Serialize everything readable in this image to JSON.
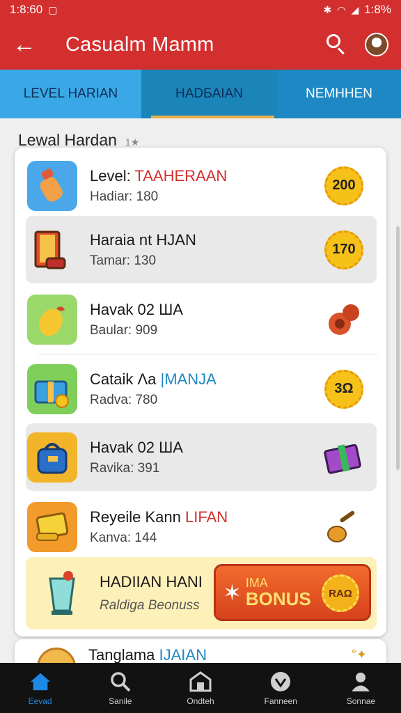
{
  "status_bar": {
    "time": "1:8:60",
    "battery": "1:8%"
  },
  "app_bar": {
    "title": "Casualm Mamm"
  },
  "tabs": [
    {
      "label": "LEVEL HARIAN"
    },
    {
      "label": "HADƂAIAN"
    },
    {
      "label": "NEMHHEN"
    }
  ],
  "section": {
    "title": "Lewal Hardan",
    "hint": "1★"
  },
  "rows": [
    {
      "name": "Level: ",
      "name_accent": "TAAHERAAN",
      "sub": "Hadiar: 180",
      "reward": "200",
      "accent": "#d32f2f"
    },
    {
      "name": "Haraia nt ",
      "name_accent": "HJAN",
      "sub": "Tamar: 130",
      "reward": "170",
      "accent": "#1a1a1a"
    },
    {
      "name": "Havak 02 ",
      "name_accent": "ШA",
      "sub": "Baular: 909",
      "reward": "",
      "accent": "#1a1a1a"
    },
    {
      "name": "Cataik  Λa ",
      "name_accent": "|ΜANJA",
      "sub": "Radva: 780",
      "reward": "3Ω",
      "accent": "#1e88c4"
    },
    {
      "name": "Havak 02 ",
      "name_accent": "ШA",
      "sub": "Ravika: 391",
      "reward": "",
      "accent": "#1a1a1a"
    },
    {
      "name": "Reyeile Kann ",
      "name_accent": "LIFAN",
      "sub": "Kanva: 144",
      "reward": "",
      "accent": "#d32f2f"
    }
  ],
  "bonus": {
    "title": "HADIIAN HANI",
    "sub": "Raldiga Beonuss",
    "button_small": "IMA",
    "button_big": "BONUS",
    "seal": "RAΩ"
  },
  "next_row": {
    "name": "Tanglama ",
    "name_accent": "IJAIAN"
  },
  "bottom_nav": [
    {
      "label": "Eevad",
      "icon": "home-icon"
    },
    {
      "label": "Sanile",
      "icon": "search-icon"
    },
    {
      "label": "Ondteh",
      "icon": "shop-icon"
    },
    {
      "label": "Fanneen",
      "icon": "heart-icon"
    },
    {
      "label": "Sonnae",
      "icon": "person-icon"
    }
  ],
  "colors": {
    "primary": "#d32f2f",
    "tab_light": "#3aa8e6",
    "tab_dark": "#1b84b8",
    "bonus_bg": "#fdf0b8",
    "nav_active": "#1e88e5"
  }
}
